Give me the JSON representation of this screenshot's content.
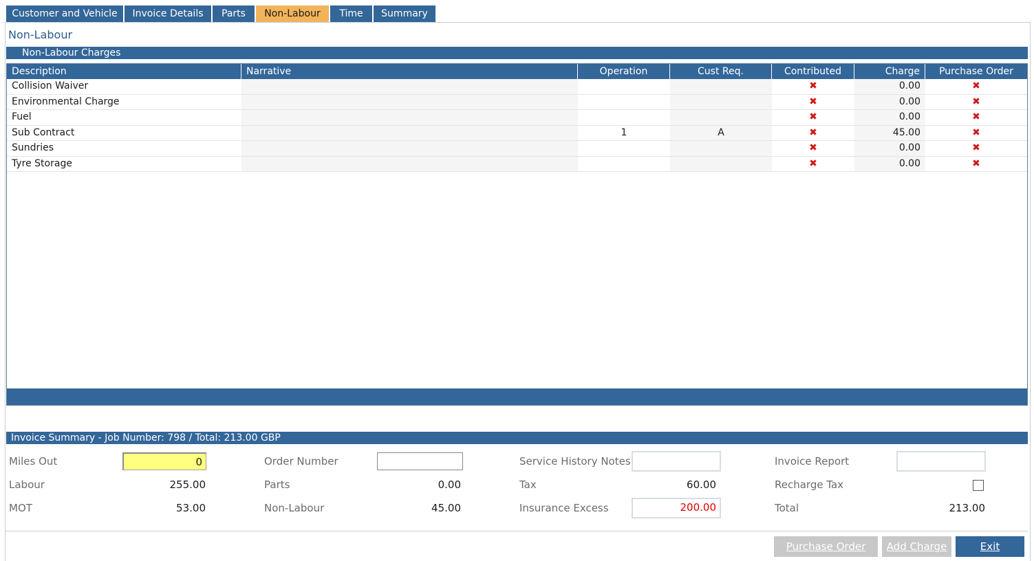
{
  "tabs": [
    {
      "label": "Customer and Vehicle"
    },
    {
      "label": "Invoice Details"
    },
    {
      "label": "Parts"
    },
    {
      "label": "Non-Labour"
    },
    {
      "label": "Time"
    },
    {
      "label": "Summary"
    }
  ],
  "active_tab": "Non-Labour",
  "section_title": "Non-Labour",
  "charges_band": "Non-Labour Charges",
  "grid": {
    "headers": {
      "description": "Description",
      "narrative": "Narrative",
      "operation": "Operation",
      "cust_req": "Cust Req.",
      "contributed": "Contributed",
      "charge": "Charge",
      "purchase_order": "Purchase Order"
    },
    "rows": [
      {
        "description": "Collision Waiver",
        "narrative": "",
        "operation": "",
        "cust_req": "",
        "contributed": "✖",
        "charge": "0.00",
        "purchase_order": "✖"
      },
      {
        "description": "Environmental Charge",
        "narrative": "",
        "operation": "",
        "cust_req": "",
        "contributed": "✖",
        "charge": "0.00",
        "purchase_order": "✖"
      },
      {
        "description": "Fuel",
        "narrative": "",
        "operation": "",
        "cust_req": "",
        "contributed": "✖",
        "charge": "0.00",
        "purchase_order": "✖"
      },
      {
        "description": "Sub Contract",
        "narrative": "",
        "operation": "1",
        "cust_req": "A",
        "contributed": "✖",
        "charge": "45.00",
        "purchase_order": "✖"
      },
      {
        "description": "Sundries",
        "narrative": "",
        "operation": "",
        "cust_req": "",
        "contributed": "✖",
        "charge": "0.00",
        "purchase_order": "✖"
      },
      {
        "description": "Tyre Storage",
        "narrative": "",
        "operation": "",
        "cust_req": "",
        "contributed": "✖",
        "charge": "0.00",
        "purchase_order": "✖"
      }
    ]
  },
  "invoice_summary": {
    "title": "Invoice Summary - Job Number: 798 / Total: 213.00 GBP",
    "miles_out_label": "Miles Out",
    "miles_out_value": "0",
    "labour_label": "Labour",
    "labour_value": "255.00",
    "mot_label": "MOT",
    "mot_value": "53.00",
    "order_number_label": "Order Number",
    "order_number_value": "",
    "parts_label": "Parts",
    "parts_value": "0.00",
    "non_labour_label": "Non-Labour",
    "non_labour_value": "45.00",
    "service_history_label": "Service History Notes",
    "service_history_value": "",
    "tax_label": "Tax",
    "tax_value": "60.00",
    "insurance_excess_label": "Insurance Excess",
    "insurance_excess_value": "200.00",
    "invoice_report_label": "Invoice Report",
    "invoice_report_value": "",
    "recharge_tax_label": "Recharge Tax",
    "recharge_tax_checked": false,
    "total_label": "Total",
    "total_value": "213.00"
  },
  "buttons": {
    "purchase_order": "Purchase Order",
    "add_charge": "Add Charge",
    "exit": "Exit"
  },
  "colors": {
    "header_blue": "#336699",
    "active_tab": "#f2b45a",
    "highlight_input": "#ffff80",
    "alert_red": "#e00000"
  }
}
